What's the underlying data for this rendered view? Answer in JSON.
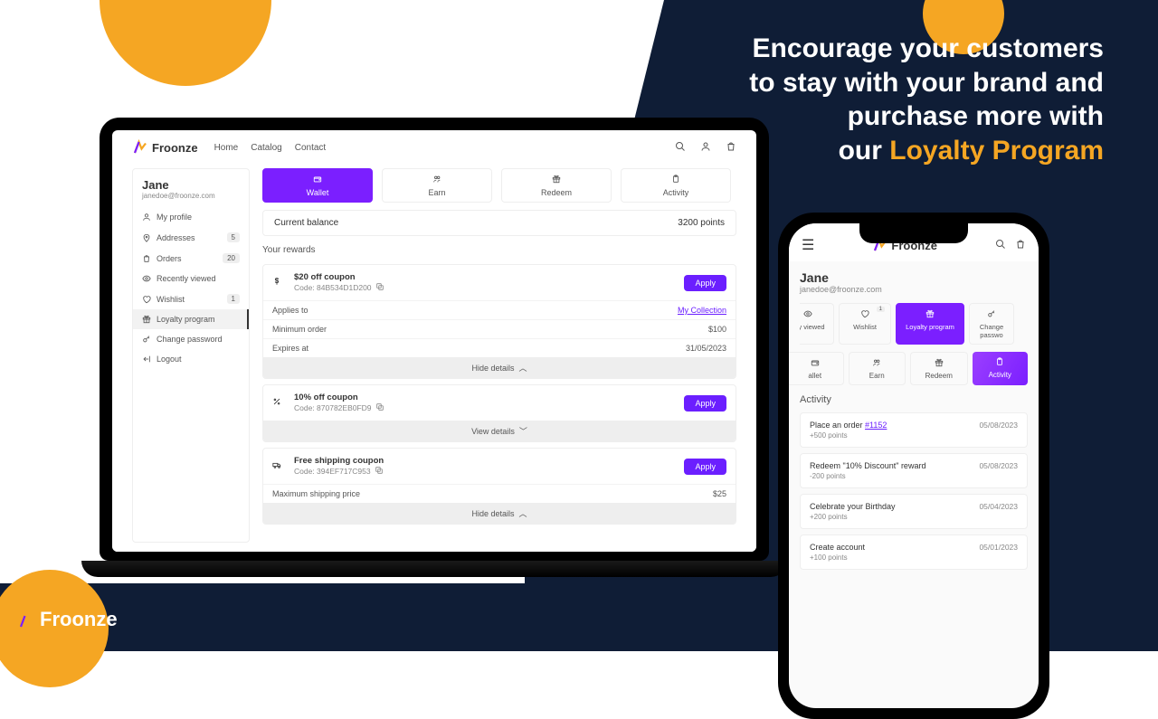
{
  "hero": {
    "line1": "Encourage your customers",
    "line2": "to stay with your brand and",
    "line3": "purchase more with",
    "line4_pre": "our ",
    "line4_accent": "Loyalty Program"
  },
  "brand": "Froonze",
  "desktop": {
    "nav": [
      "Home",
      "Catalog",
      "Contact"
    ],
    "user": {
      "name": "Jane",
      "email": "janedoe@froonze.com"
    },
    "sidebar": {
      "items": [
        {
          "icon": "user",
          "label": "My profile"
        },
        {
          "icon": "pin",
          "label": "Addresses",
          "badge": "5"
        },
        {
          "icon": "bag",
          "label": "Orders",
          "badge": "20"
        },
        {
          "icon": "eye",
          "label": "Recently viewed"
        },
        {
          "icon": "heart",
          "label": "Wishlist",
          "badge": "1"
        },
        {
          "icon": "gift",
          "label": "Loyalty program",
          "active": true
        },
        {
          "icon": "key",
          "label": "Change password"
        },
        {
          "icon": "logout",
          "label": "Logout"
        }
      ]
    },
    "tabs": [
      {
        "icon": "wallet",
        "label": "Wallet",
        "active": true
      },
      {
        "icon": "earn",
        "label": "Earn"
      },
      {
        "icon": "gift",
        "label": "Redeem"
      },
      {
        "icon": "clip",
        "label": "Activity"
      }
    ],
    "balance": {
      "label": "Current balance",
      "value": "3200 points"
    },
    "rewards_title": "Your rewards",
    "rewards": [
      {
        "icon": "dollar",
        "title": "$20 off coupon",
        "code": "Code: 84B534D1D200",
        "apply": "Apply",
        "rows": [
          [
            "Applies to",
            "My Collection",
            "link"
          ],
          [
            "Minimum order",
            "$100"
          ],
          [
            "Expires at",
            "31/05/2023"
          ]
        ],
        "toggle": "Hide details"
      },
      {
        "icon": "percent",
        "title": "10% off coupon",
        "code": "Code: 870782EB0FD9",
        "apply": "Apply",
        "toggle": "View details"
      },
      {
        "icon": "truck",
        "title": "Free shipping coupon",
        "code": "Code: 394EF717C953",
        "apply": "Apply",
        "rows": [
          [
            "Maximum shipping price",
            "$25"
          ]
        ],
        "toggle": "Hide details"
      }
    ]
  },
  "mobile": {
    "user": {
      "name": "Jane",
      "email": "janedoe@froonze.com"
    },
    "nav": [
      {
        "label": "ntly viewed",
        "icon": "eye"
      },
      {
        "label": "Wishlist",
        "icon": "heart",
        "badge": "1"
      },
      {
        "label": "Loyalty program",
        "icon": "gift",
        "active": true
      },
      {
        "label": "Change passwo",
        "icon": "key"
      }
    ],
    "tabs": [
      {
        "label": "allet",
        "icon": "wallet"
      },
      {
        "label": "Earn",
        "icon": "earn"
      },
      {
        "label": "Redeem",
        "icon": "gift"
      },
      {
        "label": "Activity",
        "icon": "clip",
        "active": true
      }
    ],
    "section_title": "Activity",
    "activity": [
      {
        "title_pre": "Place an order ",
        "link": "#1152",
        "points": "+500 points",
        "date": "05/08/2023"
      },
      {
        "title": "Redeem \"10% Discount\" reward",
        "points": "-200 points",
        "date": "05/08/2023"
      },
      {
        "title": "Celebrate your Birthday",
        "points": "+200 points",
        "date": "05/04/2023"
      },
      {
        "title": "Create account",
        "points": "+100 points",
        "date": "05/01/2023"
      }
    ]
  }
}
